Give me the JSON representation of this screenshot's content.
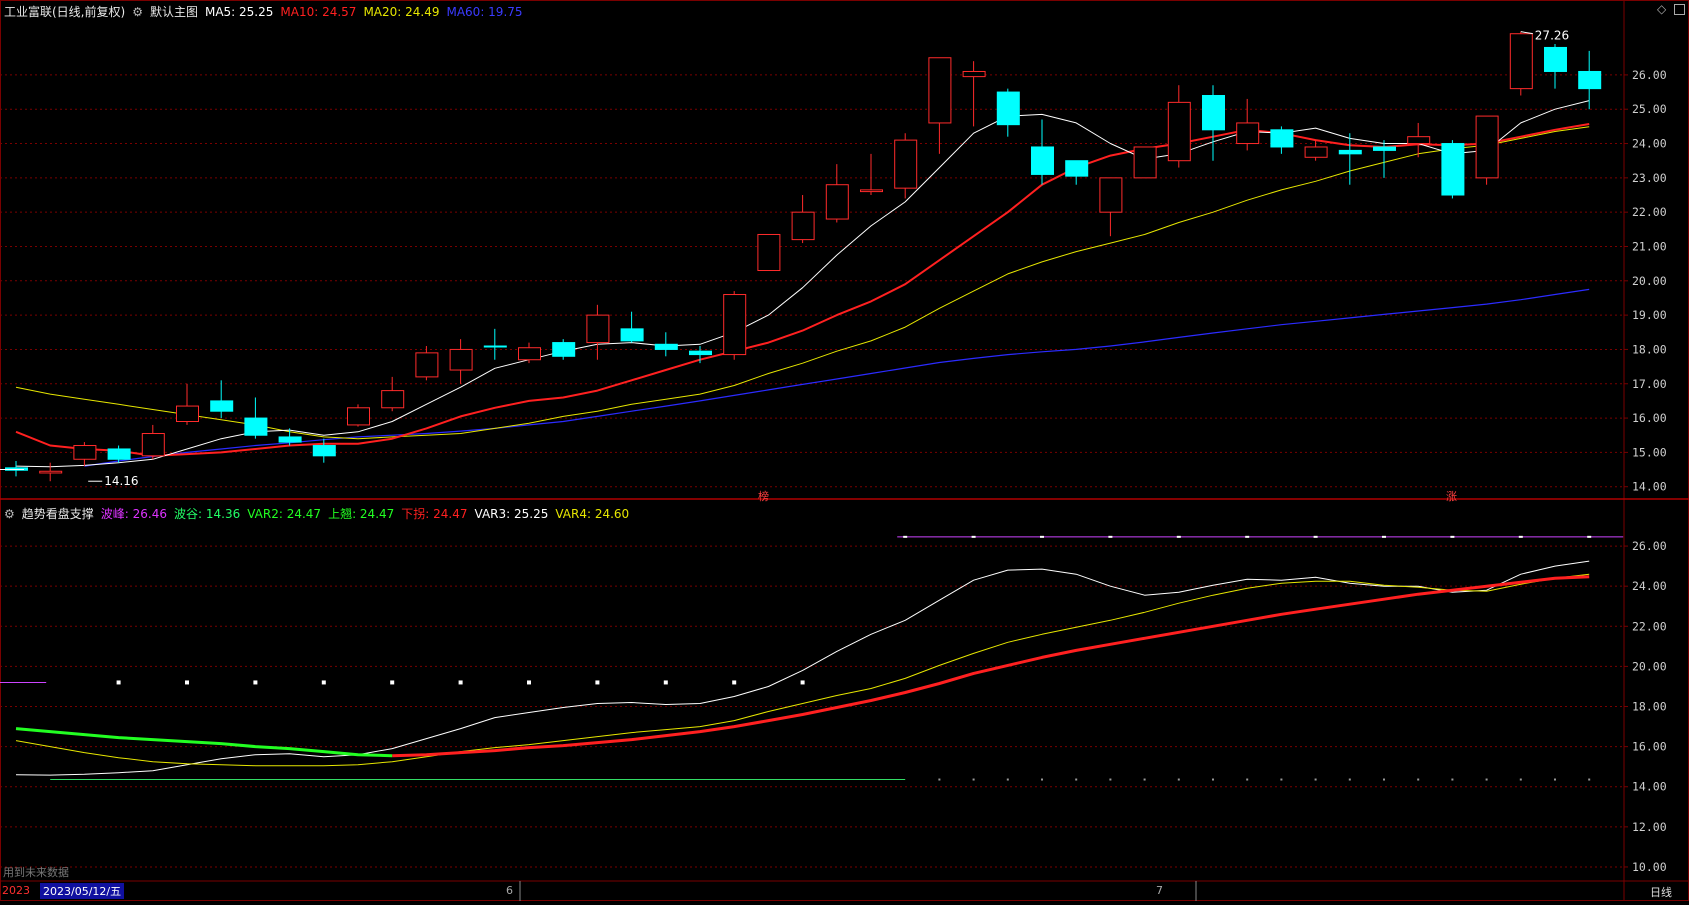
{
  "colors": {
    "up": "#ff2b2b",
    "down": "#00ffff",
    "ma5": "#ffffff",
    "ma10": "#ff2020",
    "ma20": "#e6e600",
    "ma60": "#2b2bff",
    "grid": "#7a0000",
    "frame": "#7a0000",
    "magenta": "#cc44ff",
    "green": "#22ff22"
  },
  "main_header": {
    "stock": "工业富联(日线,前复权)",
    "template": "默认主图",
    "ma5": "MA5: 25.25",
    "ma10": "MA10: 24.57",
    "ma20": "MA20: 24.49",
    "ma60": "MA60: 19.75"
  },
  "sub_header": {
    "name": "趋势看盘支撑",
    "peak": "波峰: 26.46",
    "valley": "波谷: 14.36",
    "var2": "VAR2: 24.47",
    "up": "上翘: 24.47",
    "down": "下拐: 24.47",
    "var3": "VAR3: 25.25",
    "var4": "VAR4: 24.60"
  },
  "top_right_icon": "diamond-icon",
  "hint_text": "用到未来数据",
  "period_label": "日线",
  "date_axis": {
    "year": "2023",
    "cursor_date": "2023/05/12/五",
    "months": [
      "6",
      "7"
    ]
  },
  "markers": {
    "bang": "榜",
    "zhang": "涨"
  },
  "chart_data": [
    {
      "type": "candlestick",
      "title": "工业富联(日线,前复权)",
      "ylim": [
        13.7,
        27.6
      ],
      "y_ticks": [
        "14.00",
        "15.00",
        "16.00",
        "17.00",
        "18.00",
        "19.00",
        "20.00",
        "21.00",
        "22.00",
        "23.00",
        "24.00",
        "25.00",
        "26.00"
      ],
      "high_label": "27.26",
      "low_label": "14.16",
      "candles": [
        {
          "o": 14.55,
          "h": 14.75,
          "l": 14.3,
          "c": 14.48
        },
        {
          "o": 14.4,
          "h": 14.7,
          "l": 14.16,
          "c": 14.45
        },
        {
          "o": 14.8,
          "h": 15.3,
          "l": 14.6,
          "c": 15.2
        },
        {
          "o": 15.1,
          "h": 15.2,
          "l": 14.7,
          "c": 14.8
        },
        {
          "o": 14.9,
          "h": 15.8,
          "l": 14.8,
          "c": 15.55
        },
        {
          "o": 15.9,
          "h": 17.0,
          "l": 15.8,
          "c": 16.35
        },
        {
          "o": 16.5,
          "h": 17.1,
          "l": 16.0,
          "c": 16.2
        },
        {
          "o": 16.0,
          "h": 16.6,
          "l": 15.4,
          "c": 15.5
        },
        {
          "o": 15.45,
          "h": 15.7,
          "l": 15.2,
          "c": 15.3
        },
        {
          "o": 15.2,
          "h": 15.4,
          "l": 14.7,
          "c": 14.9
        },
        {
          "o": 15.8,
          "h": 16.4,
          "l": 15.75,
          "c": 16.3
        },
        {
          "o": 16.3,
          "h": 17.2,
          "l": 16.2,
          "c": 16.8
        },
        {
          "o": 17.2,
          "h": 18.1,
          "l": 17.1,
          "c": 17.9
        },
        {
          "o": 17.4,
          "h": 18.3,
          "l": 17.0,
          "c": 18.0
        },
        {
          "o": 18.1,
          "h": 18.6,
          "l": 17.7,
          "c": 18.08
        },
        {
          "o": 17.7,
          "h": 18.2,
          "l": 17.6,
          "c": 18.05
        },
        {
          "o": 18.2,
          "h": 18.3,
          "l": 17.7,
          "c": 17.8
        },
        {
          "o": 18.2,
          "h": 19.3,
          "l": 17.7,
          "c": 19.0
        },
        {
          "o": 18.6,
          "h": 19.1,
          "l": 18.2,
          "c": 18.25
        },
        {
          "o": 18.15,
          "h": 18.5,
          "l": 17.8,
          "c": 18.0
        },
        {
          "o": 17.95,
          "h": 18.1,
          "l": 17.6,
          "c": 17.85
        },
        {
          "o": 17.85,
          "h": 19.7,
          "l": 17.7,
          "c": 19.6
        },
        {
          "o": 20.3,
          "h": 21.3,
          "l": 20.3,
          "c": 21.35
        },
        {
          "o": 21.2,
          "h": 22.5,
          "l": 21.1,
          "c": 22.0
        },
        {
          "o": 21.8,
          "h": 23.4,
          "l": 21.7,
          "c": 22.8
        },
        {
          "o": 22.6,
          "h": 23.7,
          "l": 22.5,
          "c": 22.65
        },
        {
          "o": 22.7,
          "h": 24.3,
          "l": 22.4,
          "c": 24.1
        },
        {
          "o": 24.6,
          "h": 26.5,
          "l": 23.7,
          "c": 26.5
        },
        {
          "o": 25.95,
          "h": 26.4,
          "l": 24.5,
          "c": 26.1
        },
        {
          "o": 25.5,
          "h": 25.6,
          "l": 24.2,
          "c": 24.55
        },
        {
          "o": 23.9,
          "h": 24.7,
          "l": 22.8,
          "c": 23.1
        },
        {
          "o": 23.5,
          "h": 23.5,
          "l": 22.8,
          "c": 23.05
        },
        {
          "o": 22.0,
          "h": 23.0,
          "l": 21.3,
          "c": 23.0
        },
        {
          "o": 23.0,
          "h": 23.9,
          "l": 23.0,
          "c": 23.9
        },
        {
          "o": 23.5,
          "h": 25.7,
          "l": 23.3,
          "c": 25.2
        },
        {
          "o": 25.4,
          "h": 25.7,
          "l": 23.5,
          "c": 24.4
        },
        {
          "o": 24.0,
          "h": 25.3,
          "l": 23.8,
          "c": 24.6
        },
        {
          "o": 24.4,
          "h": 24.5,
          "l": 23.7,
          "c": 23.9
        },
        {
          "o": 23.6,
          "h": 24.1,
          "l": 23.5,
          "c": 23.9
        },
        {
          "o": 23.8,
          "h": 24.3,
          "l": 22.8,
          "c": 23.7
        },
        {
          "o": 23.9,
          "h": 24.1,
          "l": 23.0,
          "c": 23.8
        },
        {
          "o": 24.0,
          "h": 24.6,
          "l": 23.6,
          "c": 24.2
        },
        {
          "o": 24.0,
          "h": 24.1,
          "l": 22.4,
          "c": 22.5
        },
        {
          "o": 23.0,
          "h": 24.8,
          "l": 22.8,
          "c": 24.8
        },
        {
          "o": 25.6,
          "h": 27.26,
          "l": 25.4,
          "c": 27.2
        },
        {
          "o": 26.8,
          "h": 26.9,
          "l": 25.6,
          "c": 26.1
        },
        {
          "o": 26.1,
          "h": 26.7,
          "l": 25.0,
          "c": 25.6
        }
      ],
      "series": [
        {
          "name": "MA5",
          "color": "#ffffff",
          "values": [
            14.6,
            14.58,
            14.62,
            14.7,
            14.8,
            15.1,
            15.4,
            15.6,
            15.65,
            15.5,
            15.6,
            15.9,
            16.4,
            16.9,
            17.45,
            17.7,
            17.95,
            18.15,
            18.2,
            18.1,
            18.15,
            18.5,
            19.0,
            19.8,
            20.75,
            21.6,
            22.3,
            23.3,
            24.3,
            24.8,
            24.85,
            24.6,
            24.0,
            23.55,
            23.7,
            24.05,
            24.35,
            24.3,
            24.45,
            24.15,
            24.0,
            24.0,
            23.7,
            23.8,
            24.6,
            25.0,
            25.25
          ]
        },
        {
          "name": "MA10",
          "color": "#ff2020",
          "values": [
            15.6,
            15.2,
            15.1,
            15.05,
            14.9,
            14.95,
            15.0,
            15.1,
            15.2,
            15.25,
            15.25,
            15.4,
            15.7,
            16.05,
            16.3,
            16.5,
            16.6,
            16.8,
            17.1,
            17.4,
            17.7,
            17.95,
            18.2,
            18.55,
            19.0,
            19.4,
            19.9,
            20.6,
            21.3,
            22.0,
            22.8,
            23.3,
            23.65,
            23.85,
            24.0,
            24.2,
            24.4,
            24.3,
            24.1,
            23.95,
            23.9,
            23.98,
            23.95,
            24.0,
            24.2,
            24.4,
            24.57
          ]
        },
        {
          "name": "MA20",
          "color": "#e6e600",
          "values": [
            16.9,
            16.7,
            16.55,
            16.4,
            16.25,
            16.1,
            15.95,
            15.8,
            15.6,
            15.45,
            15.4,
            15.45,
            15.5,
            15.55,
            15.7,
            15.85,
            16.05,
            16.2,
            16.4,
            16.55,
            16.7,
            16.95,
            17.3,
            17.6,
            17.95,
            18.25,
            18.65,
            19.2,
            19.7,
            20.2,
            20.55,
            20.85,
            21.1,
            21.35,
            21.7,
            22.0,
            22.35,
            22.65,
            22.9,
            23.2,
            23.45,
            23.7,
            23.85,
            23.95,
            24.15,
            24.35,
            24.49
          ]
        },
        {
          "name": "MA60",
          "color": "#2b2bff",
          "values": [
            null,
            null,
            14.6,
            14.75,
            14.88,
            15.0,
            15.1,
            15.2,
            15.28,
            15.37,
            15.45,
            15.5,
            15.55,
            15.62,
            15.7,
            15.8,
            15.9,
            16.05,
            16.2,
            16.35,
            16.5,
            16.66,
            16.82,
            16.98,
            17.14,
            17.3,
            17.46,
            17.62,
            17.74,
            17.85,
            17.93,
            18.0,
            18.1,
            18.22,
            18.35,
            18.48,
            18.6,
            18.72,
            18.82,
            18.92,
            19.02,
            19.12,
            19.22,
            19.32,
            19.45,
            19.6,
            19.75
          ]
        }
      ]
    },
    {
      "type": "line",
      "title": "趋势看盘支撑",
      "ylim": [
        9.4,
        27.3
      ],
      "y_ticks": [
        "10.00",
        "12.00",
        "14.00",
        "16.00",
        "18.00",
        "20.00",
        "22.00",
        "24.00",
        "26.00"
      ],
      "series": [
        {
          "name": "VAR3",
          "color": "#ffffff",
          "values": [
            14.6,
            14.58,
            14.62,
            14.7,
            14.8,
            15.1,
            15.4,
            15.6,
            15.65,
            15.5,
            15.6,
            15.9,
            16.4,
            16.9,
            17.45,
            17.7,
            17.95,
            18.15,
            18.2,
            18.1,
            18.15,
            18.5,
            19.0,
            19.8,
            20.75,
            21.6,
            22.3,
            23.3,
            24.3,
            24.8,
            24.85,
            24.6,
            24.0,
            23.55,
            23.7,
            24.05,
            24.35,
            24.3,
            24.45,
            24.15,
            24.0,
            24.0,
            23.7,
            23.8,
            24.6,
            25.0,
            25.25
          ]
        },
        {
          "name": "VAR4",
          "color": "#e6e600",
          "values": [
            16.3,
            16.0,
            15.7,
            15.45,
            15.25,
            15.15,
            15.1,
            15.05,
            15.05,
            15.05,
            15.1,
            15.25,
            15.5,
            15.75,
            15.95,
            16.1,
            16.3,
            16.5,
            16.7,
            16.85,
            17.0,
            17.3,
            17.75,
            18.15,
            18.55,
            18.9,
            19.4,
            20.05,
            20.65,
            21.2,
            21.6,
            21.95,
            22.3,
            22.7,
            23.15,
            23.55,
            23.9,
            24.15,
            24.25,
            24.25,
            24.05,
            23.95,
            23.8,
            23.75,
            24.1,
            24.4,
            24.6
          ]
        },
        {
          "name": "上翘",
          "color": "#ff2020",
          "values": [
            null,
            null,
            null,
            null,
            null,
            null,
            null,
            null,
            null,
            null,
            null,
            15.55,
            15.6,
            15.7,
            15.8,
            15.95,
            16.05,
            16.2,
            16.35,
            16.55,
            16.75,
            17.0,
            17.3,
            17.6,
            17.95,
            18.3,
            18.7,
            19.15,
            19.65,
            20.05,
            20.45,
            20.8,
            21.1,
            21.4,
            21.7,
            22.0,
            22.3,
            22.6,
            22.85,
            23.1,
            23.35,
            23.6,
            23.8,
            24.0,
            24.2,
            24.4,
            24.47
          ]
        },
        {
          "name": "下拐",
          "color": "#22ff22",
          "values": [
            16.9,
            16.75,
            16.6,
            16.45,
            16.35,
            16.25,
            16.15,
            16.0,
            15.9,
            15.75,
            15.6,
            15.55,
            null,
            null,
            null,
            null,
            null,
            null,
            null,
            null,
            null,
            null,
            null,
            null,
            null,
            null,
            null,
            null,
            null,
            null,
            null,
            null,
            null,
            null,
            null,
            null,
            null,
            null,
            null,
            null,
            null,
            null,
            null,
            null,
            null,
            null,
            null
          ]
        },
        {
          "name": "波峰",
          "color": "#cc44ff",
          "value": 26.46
        },
        {
          "name": "波谷",
          "color": "#22ff22",
          "value": 14.36
        }
      ]
    }
  ]
}
